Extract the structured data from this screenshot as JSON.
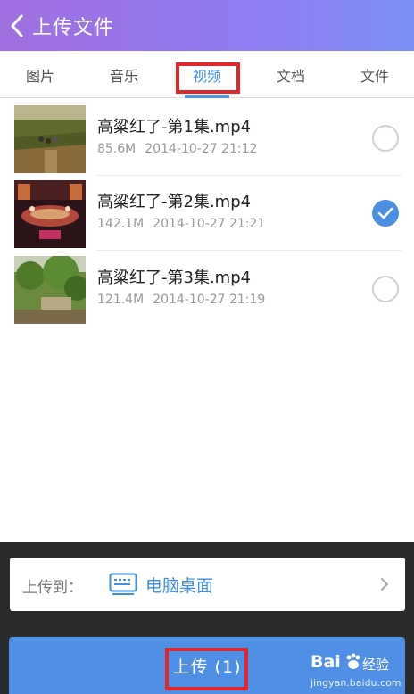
{
  "header": {
    "title": "上传文件",
    "back_icon": "chevron-left-icon"
  },
  "tabs": [
    {
      "label": "图片",
      "active": false
    },
    {
      "label": "音乐",
      "active": false
    },
    {
      "label": "视频",
      "active": true
    },
    {
      "label": "文档",
      "active": false
    },
    {
      "label": "文件",
      "active": false
    }
  ],
  "files": [
    {
      "name": "高粱红了-第1集.mp4",
      "size": "85.6M",
      "date": "2014-10-27 21:12",
      "selected": false
    },
    {
      "name": "高粱红了-第2集.mp4",
      "size": "142.1M",
      "date": "2014-10-27 21:21",
      "selected": true
    },
    {
      "name": "高粱红了-第3集.mp4",
      "size": "121.4M",
      "date": "2014-10-27 21:19",
      "selected": false
    }
  ],
  "destination": {
    "label": "上传到：",
    "value": "电脑桌面",
    "icon": "computer-icon"
  },
  "upload_button": {
    "label": "上传 (1)"
  },
  "watermark": {
    "brand": "Bai",
    "brand_cn": "经验",
    "url": "jingyan.baidu.com"
  },
  "colors": {
    "accent": "#4f8fe6",
    "highlight": "#e0282c",
    "header_start": "#a16fe0",
    "header_end": "#7d8ef4"
  }
}
